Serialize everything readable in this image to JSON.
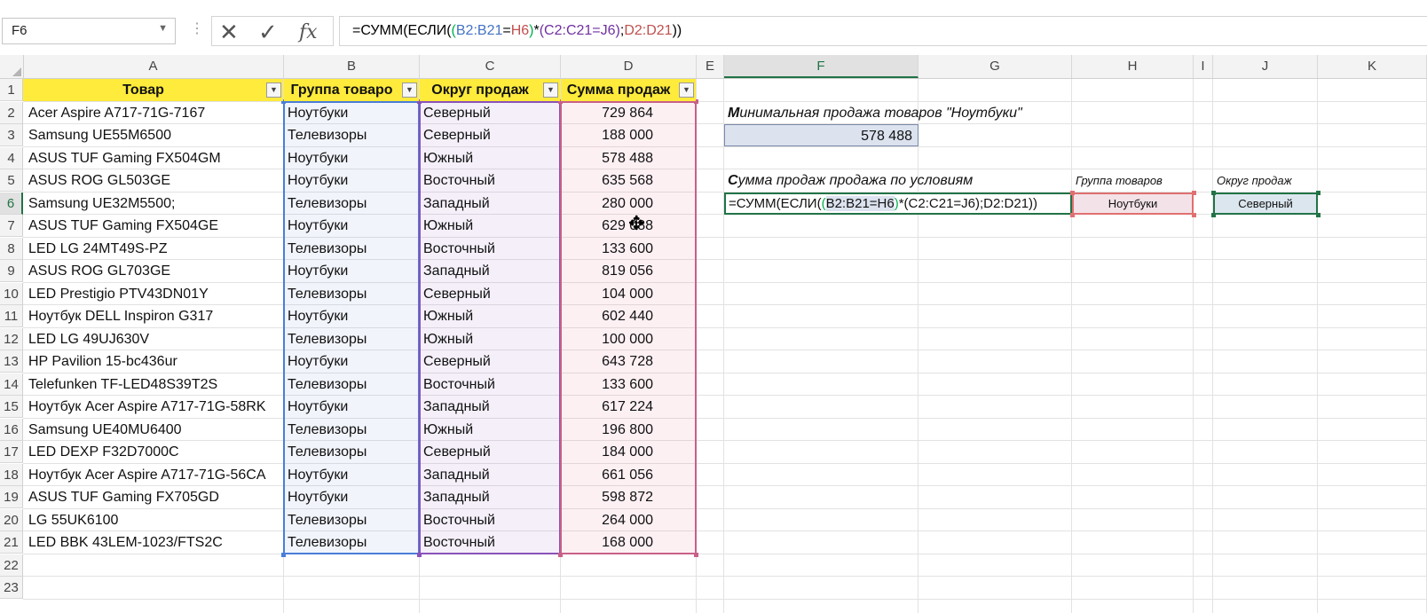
{
  "name_box": "F6",
  "formula_bar": {
    "p1": "=СУММ(ЕСЛИ(",
    "p2": "(",
    "p3": "B2:B21",
    "p4": "=",
    "p5": "H6",
    "p6": ")",
    "p7": "*",
    "p8": "(C2:C21=J6)",
    "p9": ";",
    "p10": "D2:D21",
    "p11": "))"
  },
  "columns": [
    "A",
    "B",
    "C",
    "D",
    "E",
    "F",
    "G",
    "H",
    "I",
    "J",
    "K"
  ],
  "row_numbers": [
    "1",
    "2",
    "3",
    "4",
    "5",
    "6",
    "7",
    "8",
    "9",
    "10",
    "11",
    "12",
    "13",
    "14",
    "15",
    "16",
    "17",
    "18",
    "19",
    "20",
    "21",
    "22",
    "23"
  ],
  "table": {
    "headers": [
      "Товар",
      "Группа товаро",
      "Округ продаж",
      "Сумма продаж"
    ],
    "rows": [
      [
        "Acer Aspire A717-71G-7167",
        "Ноутбуки",
        "Северный",
        "729 864"
      ],
      [
        "Samsung UE55M6500",
        "Телевизоры",
        "Северный",
        "188 000"
      ],
      [
        "ASUS TUF Gaming FX504GM",
        "Ноутбуки",
        "Южный",
        "578 488"
      ],
      [
        "ASUS ROG GL503GE",
        "Ноутбуки",
        "Восточный",
        "635 568"
      ],
      [
        "Samsung UE32M5500;",
        "Телевизоры",
        "Западный",
        "280 000"
      ],
      [
        "ASUS TUF Gaming FX504GE",
        "Ноутбуки",
        "Южный",
        "629 088"
      ],
      [
        "LED LG 24MT49S-PZ",
        "Телевизоры",
        "Восточный",
        "133 600"
      ],
      [
        "ASUS ROG GL703GE",
        "Ноутбуки",
        "Западный",
        "819 056"
      ],
      [
        "LED Prestigio PTV43DN01Y",
        "Телевизоры",
        "Северный",
        "104 000"
      ],
      [
        "Ноутбук DELL Inspiron G317",
        "Ноутбуки",
        "Южный",
        "602 440"
      ],
      [
        "LED LG 49UJ630V",
        "Телевизоры",
        "Южный",
        "100 000"
      ],
      [
        "HP Pavilion 15-bc436ur",
        "Ноутбуки",
        "Северный",
        "643 728"
      ],
      [
        "Telefunken TF-LED48S39T2S",
        "Телевизоры",
        "Восточный",
        "133 600"
      ],
      [
        "Ноутбук Acer Aspire A717-71G-58RK",
        "Ноутбуки",
        "Западный",
        "617 224"
      ],
      [
        "Samsung UE40MU6400",
        "Телевизоры",
        "Южный",
        "196 800"
      ],
      [
        "LED DEXP F32D7000C",
        "Телевизоры",
        "Северный",
        "184 000"
      ],
      [
        "Ноутбук Acer Aspire A717-71G-56CA",
        "Ноутбуки",
        "Западный",
        "661 056"
      ],
      [
        "ASUS TUF Gaming FX705GD",
        "Ноутбуки",
        "Западный",
        "598 872"
      ],
      [
        "LG 55UK6100",
        "Телевизоры",
        "Восточный",
        "264 000"
      ],
      [
        "LED BBK 43LEM-1023/FTS2C",
        "Телевизоры",
        "Восточный",
        "168 000"
      ]
    ]
  },
  "min_sale": {
    "label_first": "М",
    "label_rest": "инимальная продажа товаров \"Ноутбуки\"",
    "value": "578 488"
  },
  "sum_sales": {
    "label_first": "С",
    "label_rest": "умма продаж  продажа по условиям",
    "formula_p1": "=СУММ(ЕСЛИ(",
    "formula_p2": "(",
    "formula_p3": "B2:B21=H6",
    "formula_p4": ")",
    "formula_p5": "*(C2:C21=J6);D2:D21))"
  },
  "criteria": {
    "group_label": "Группа товаров",
    "group_value": "Ноутбуки",
    "region_label": "Округ продаж",
    "region_value": "Северный"
  },
  "colors": {
    "header_fill": "#ffeb3b",
    "range_b": "#4a7ed8",
    "range_c": "#8a52b8",
    "range_d": "#c86088",
    "selection": "#217346"
  }
}
